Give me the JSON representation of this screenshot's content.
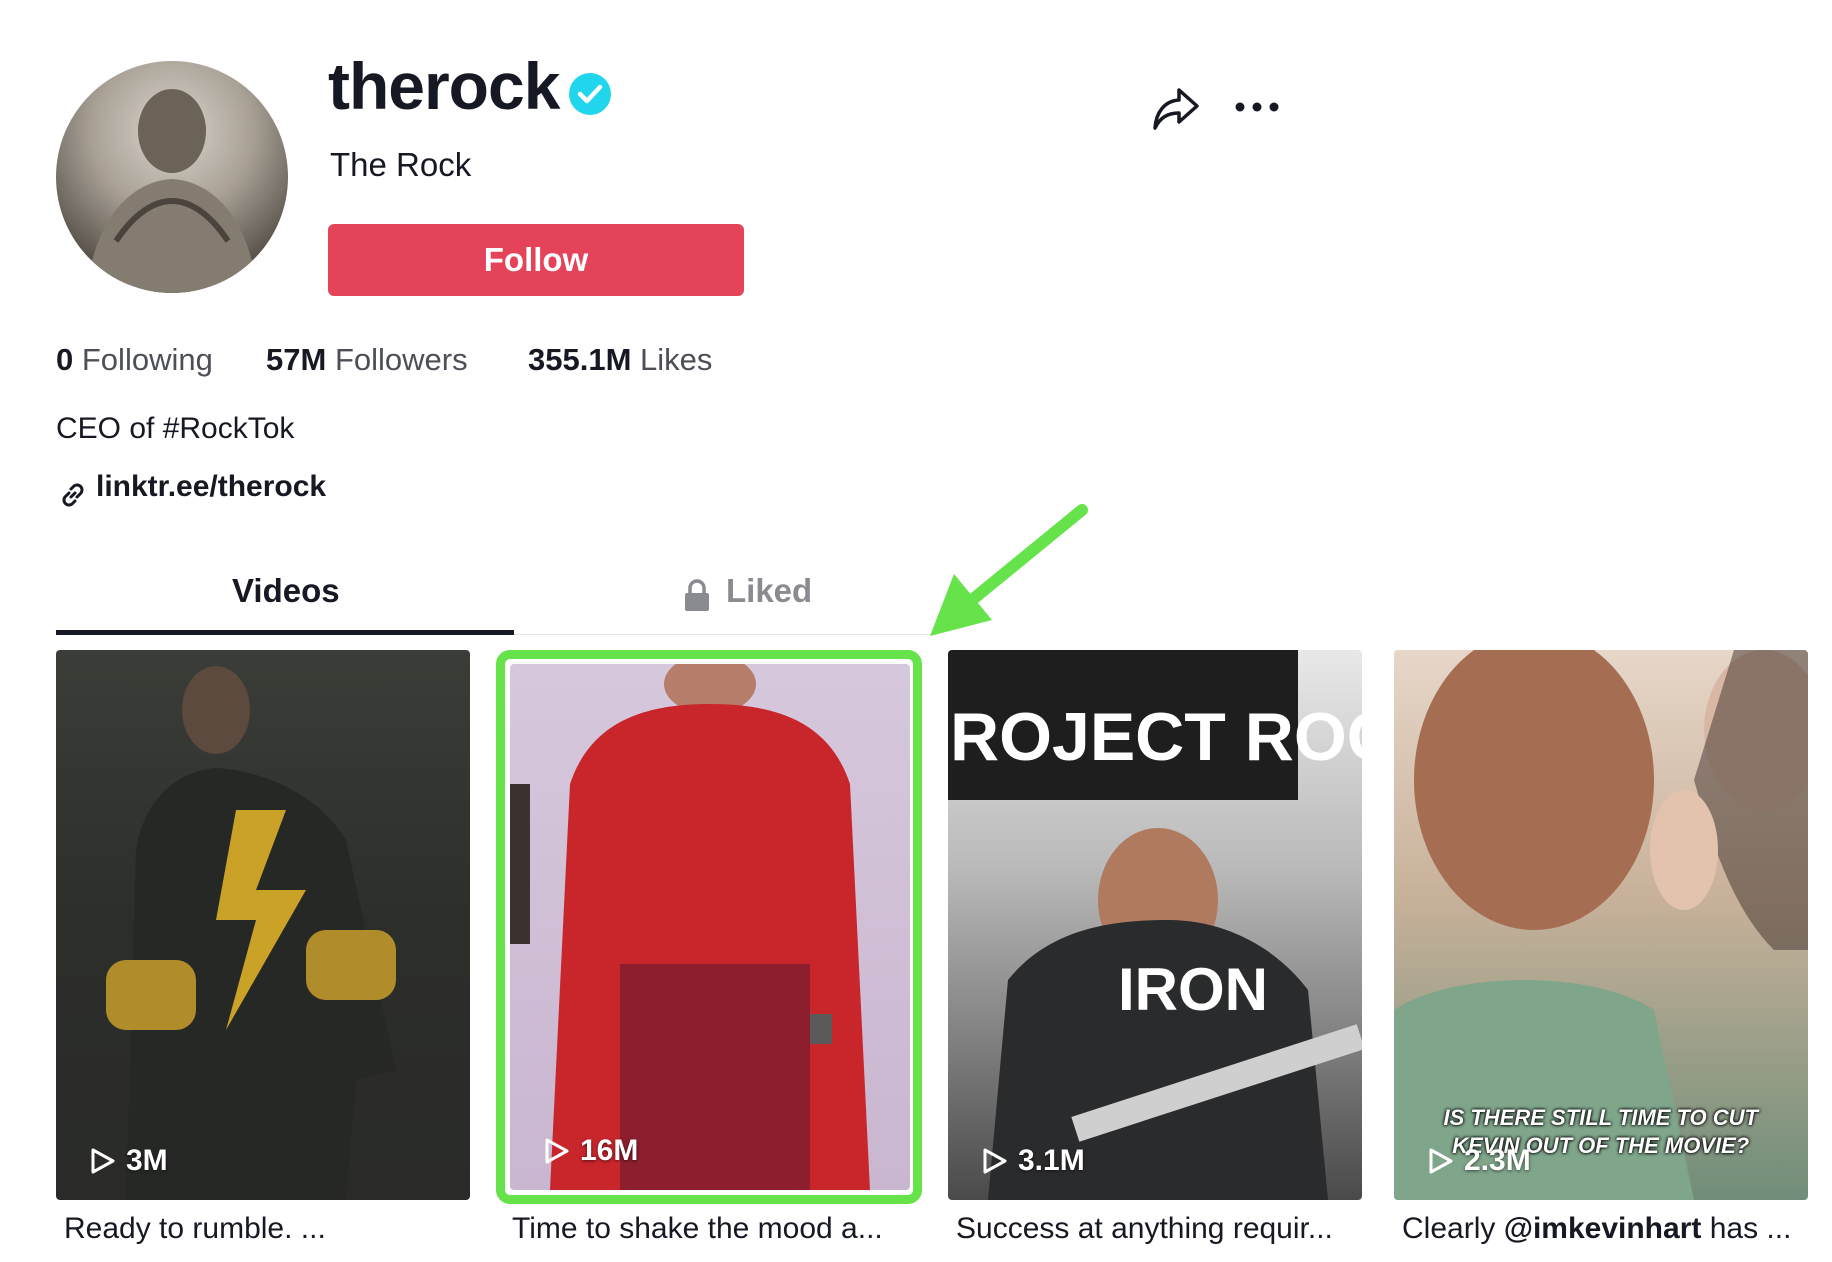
{
  "profile": {
    "username": "therock",
    "nickname": "The Rock",
    "follow_label": "Follow",
    "bio": "CEO of #RockTok",
    "link": "linktr.ee/therock"
  },
  "stats": {
    "following_count": "0",
    "following_label": "Following",
    "followers_count": "57M",
    "followers_label": "Followers",
    "likes_count": "355.1M",
    "likes_label": "Likes"
  },
  "tabs": {
    "videos": "Videos",
    "liked": "Liked"
  },
  "videos": [
    {
      "views": "3M",
      "caption": "Ready to rumble. ..."
    },
    {
      "views": "16M",
      "caption": "Time to shake the mood a..."
    },
    {
      "views": "3.1M",
      "caption": "Success at anything requir..."
    },
    {
      "views": "2.3M",
      "caption_prefix": "Clearly ",
      "caption_mention": "@imkevinhart",
      "caption_suffix": " has ...",
      "overlay_text_1": "IS THERE STILL TIME TO CUT",
      "overlay_text_2": "KEVIN OUT OF THE MOVIE?"
    }
  ],
  "thumbnail_text": {
    "banner": "ROJECT ROCK",
    "shirt": "IRON"
  },
  "colors": {
    "follow_button": "#e5435a",
    "verified_badge": "#20d5ec",
    "annotation_green": "#66e24a"
  },
  "icons": [
    "verified-icon",
    "share-icon",
    "more-icon",
    "link-icon",
    "lock-icon",
    "play-icon"
  ]
}
